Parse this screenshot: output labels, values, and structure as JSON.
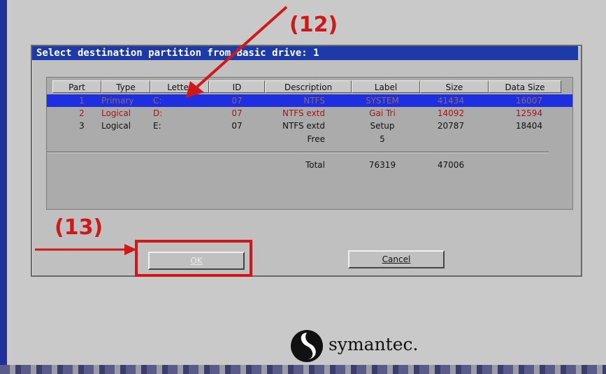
{
  "dialog": {
    "title": "Select destination partition from Basic drive: 1"
  },
  "table": {
    "headers": [
      "Part",
      "Type",
      "Letter",
      "ID",
      "Description",
      "Label",
      "Size",
      "Data Size"
    ],
    "rows": [
      {
        "part": "1",
        "type": "Primary",
        "letter": "C:",
        "id": "07",
        "description": "NTFS",
        "label": "SYSTEM",
        "size": "41434",
        "data_size": "16007",
        "state": "selected"
      },
      {
        "part": "2",
        "type": "Logical",
        "letter": "D:",
        "id": "07",
        "description": "NTFS extd",
        "label": "Gai Tri",
        "size": "14092",
        "data_size": "12594",
        "state": "red"
      },
      {
        "part": "3",
        "type": "Logical",
        "letter": "E:",
        "id": "07",
        "description": "NTFS extd",
        "label": "Setup",
        "size": "20787",
        "data_size": "18404",
        "state": "normal"
      }
    ],
    "free": {
      "description": "Free",
      "label": "5"
    },
    "total": {
      "description": "Total",
      "label": "76319",
      "size": "47006"
    }
  },
  "buttons": {
    "ok_label": "OK",
    "cancel_label": "Cancel"
  },
  "annotations": {
    "step12": "(12)",
    "step13": "(13)"
  },
  "logo": {
    "text": "symantec."
  },
  "colors": {
    "title_bar": "#1c3aa8",
    "selection": "#1f2fe0",
    "annotation_red": "#d11818",
    "dialog_bg": "#c0c0c0"
  }
}
